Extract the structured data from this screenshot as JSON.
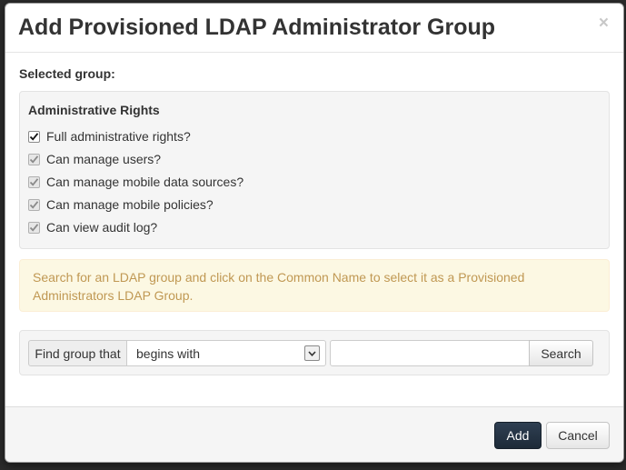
{
  "modal": {
    "title": "Add Provisioned LDAP Administrator Group",
    "close_glyph": "×"
  },
  "selected_group": {
    "label": "Selected group:"
  },
  "rights": {
    "title": "Administrative Rights",
    "items": [
      {
        "label": "Full administrative rights?",
        "checked": true,
        "disabled": false
      },
      {
        "label": "Can manage users?",
        "checked": true,
        "disabled": true
      },
      {
        "label": "Can manage mobile data sources?",
        "checked": true,
        "disabled": true
      },
      {
        "label": "Can manage mobile policies?",
        "checked": true,
        "disabled": true
      },
      {
        "label": "Can view audit log?",
        "checked": true,
        "disabled": true
      }
    ]
  },
  "alert": {
    "text": "Search for an LDAP group and click on the Common Name to select it as a Provisioned Administrators LDAP Group."
  },
  "search": {
    "addon_label": "Find group that",
    "match_mode": "begins with",
    "query_value": "",
    "button_label": "Search"
  },
  "footer": {
    "add_label": "Add",
    "cancel_label": "Cancel"
  },
  "colors": {
    "primary_button": "#1d2a38",
    "alert_background": "#fcf8e3",
    "alert_text": "#c09853"
  }
}
